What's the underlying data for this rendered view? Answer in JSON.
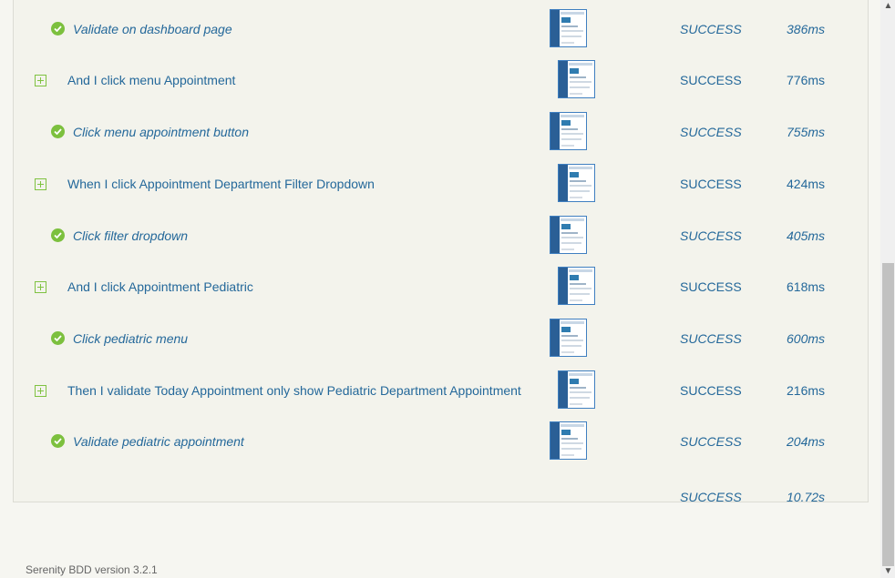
{
  "steps": [
    {
      "kind": "child",
      "label": "Validate on dashboard page",
      "result": "SUCCESS",
      "duration": "386ms"
    },
    {
      "kind": "parent",
      "label": "And I click menu Appointment",
      "result": "SUCCESS",
      "duration": "776ms"
    },
    {
      "kind": "child",
      "label": "Click menu appointment button",
      "result": "SUCCESS",
      "duration": "755ms"
    },
    {
      "kind": "parent",
      "label": "When I click Appointment Department Filter Dropdown",
      "result": "SUCCESS",
      "duration": "424ms"
    },
    {
      "kind": "child",
      "label": "Click filter dropdown",
      "result": "SUCCESS",
      "duration": "405ms"
    },
    {
      "kind": "parent",
      "label": "And I click Appointment Pediatric",
      "result": "SUCCESS",
      "duration": "618ms"
    },
    {
      "kind": "child",
      "label": "Click pediatric menu",
      "result": "SUCCESS",
      "duration": "600ms"
    },
    {
      "kind": "parent",
      "label": "Then I validate Today Appointment only show Pediatric Department Appointment",
      "result": "SUCCESS",
      "duration": "216ms"
    },
    {
      "kind": "child",
      "label": "Validate pediatric appointment",
      "result": "SUCCESS",
      "duration": "204ms"
    }
  ],
  "total": {
    "result": "SUCCESS",
    "duration": "10.72s"
  },
  "footer": {
    "version": "Serenity BDD version 3.2.1"
  },
  "colors": {
    "link": "#24689a",
    "success_icon": "#7cc03e",
    "panel_bg": "#f3f3ec"
  }
}
